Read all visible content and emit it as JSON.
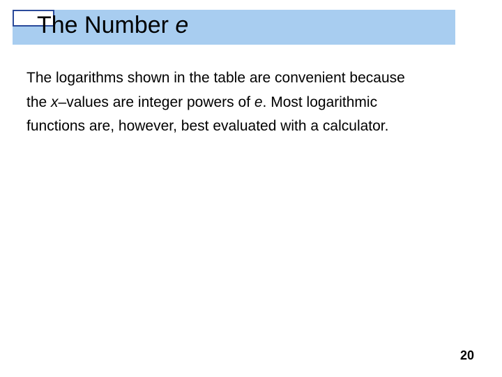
{
  "title": {
    "prefix": "The Number ",
    "italic": "e"
  },
  "body": {
    "line1": "The logarithms shown in the table are convenient because",
    "line2a": "the ",
    "line2b": "x",
    "line2c": "–values are integer powers of ",
    "line2d": "e",
    "line2e": ". Most logarithmic",
    "line3": "functions are, however, best evaluated with a calculator."
  },
  "page_number": "20"
}
